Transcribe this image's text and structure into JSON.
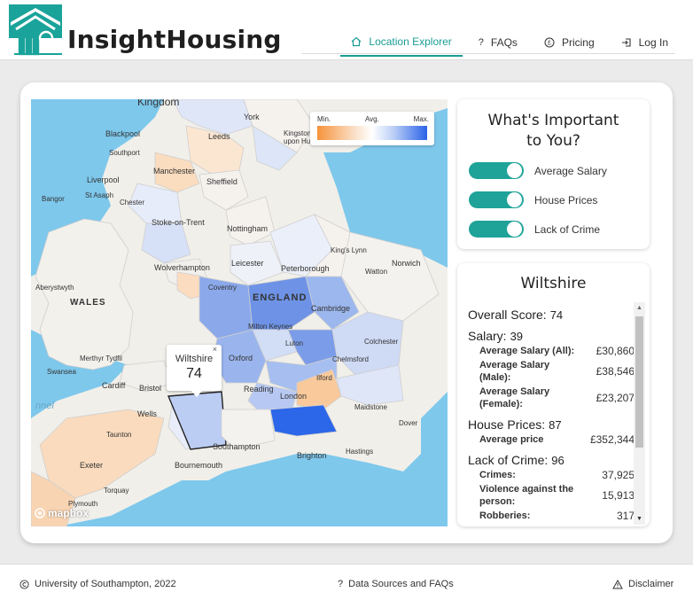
{
  "app": {
    "brand": "InsightHousing"
  },
  "nav": [
    {
      "label": "Location Explorer",
      "icon": "home-icon",
      "active": true
    },
    {
      "label": "FAQs",
      "icon": "question-icon"
    },
    {
      "label": "Pricing",
      "icon": "pound-icon"
    },
    {
      "label": "Log In",
      "icon": "login-icon"
    }
  ],
  "map": {
    "legend": {
      "min": "Min.",
      "avg": "Avg.",
      "max": "Max."
    },
    "labels": {
      "kingdom": "Kingdom",
      "york": "York",
      "leeds": "Leeds",
      "blackpool": "Blackpool",
      "southport": "Southport",
      "kingston": "Kingston",
      "upon_hu": "upon Hu",
      "manchester": "Manchester",
      "liverpool": "Liverpool",
      "st_asaph": "St Asaph",
      "sheffield": "Sheffield",
      "bangor": "Bangor",
      "chester": "Chester",
      "stoke": "Stoke-on-Trent",
      "nottingham": "Nottingham",
      "kings_lynn": "King's Lynn",
      "wolverhampton": "Wolverhampton",
      "leicester": "Leicester",
      "peterborough": "Peterborough",
      "watton": "Watton",
      "norwich": "Norwich",
      "aberystwyth": "Aberystwyth",
      "coventry": "Coventry",
      "england": "ENGLAND",
      "wales": "WALES",
      "cambridge": "Cambridge",
      "milton_keynes": "Milton Keynes",
      "luton": "Luton",
      "colchester": "Colchester",
      "merthyr": "Merthyr Tydfil",
      "oxford": "Oxford",
      "chelmsford": "Chelmsford",
      "swansea": "Swansea",
      "cardiff": "Cardiff",
      "bristol": "Bristol",
      "ilford": "Ilford",
      "reading": "Reading",
      "london": "London",
      "maidstone": "Maidstone",
      "wells": "Wells",
      "dover": "Dover",
      "taunton": "Taunton",
      "southampton": "Southampton",
      "brighton": "Brighton",
      "hastings": "Hastings",
      "exeter": "Exeter",
      "bournemouth": "Bournemouth",
      "torquay": "Torquay",
      "plymouth": "Plymouth",
      "channel": "nnel"
    },
    "tooltip": {
      "name": "Wiltshire",
      "score": "74",
      "close": "×"
    },
    "attribution": "mapbox"
  },
  "preferences": {
    "title": "What's Important to You?",
    "toggles": [
      {
        "label": "Average Salary",
        "on": true
      },
      {
        "label": "House Prices",
        "on": true
      },
      {
        "label": "Lack of Crime",
        "on": true
      }
    ]
  },
  "details": {
    "region": "Wiltshire",
    "overall_label": "Overall Score:",
    "overall_value": "74",
    "salary": {
      "label": "Salary:",
      "score": "39",
      "rows": [
        {
          "label": "Average Salary (All):",
          "value": "£30,860"
        },
        {
          "label": "Average Salary (Male):",
          "value": "£38,546"
        },
        {
          "label": "Average Salary (Female):",
          "value": "£23,207"
        }
      ]
    },
    "house": {
      "label": "House Prices:",
      "score": "87",
      "rows": [
        {
          "label": "Average price",
          "value": "£352,344"
        }
      ]
    },
    "crime": {
      "label": "Lack of Crime:",
      "score": "96",
      "rows": [
        {
          "label": "Crimes:",
          "value": "37,925"
        },
        {
          "label": "Violence against the person:",
          "value": "15,913"
        },
        {
          "label": "Robberies:",
          "value": "317"
        }
      ]
    }
  },
  "footer": {
    "copyright": "University of Southampton, 2022",
    "sources": "Data Sources and FAQs",
    "disclaimer": "Disclaimer"
  },
  "colors": {
    "accent": "#1a9c95",
    "toggle": "#1fa399",
    "sea": "#7ec8ec",
    "land": "#f1efe9"
  }
}
